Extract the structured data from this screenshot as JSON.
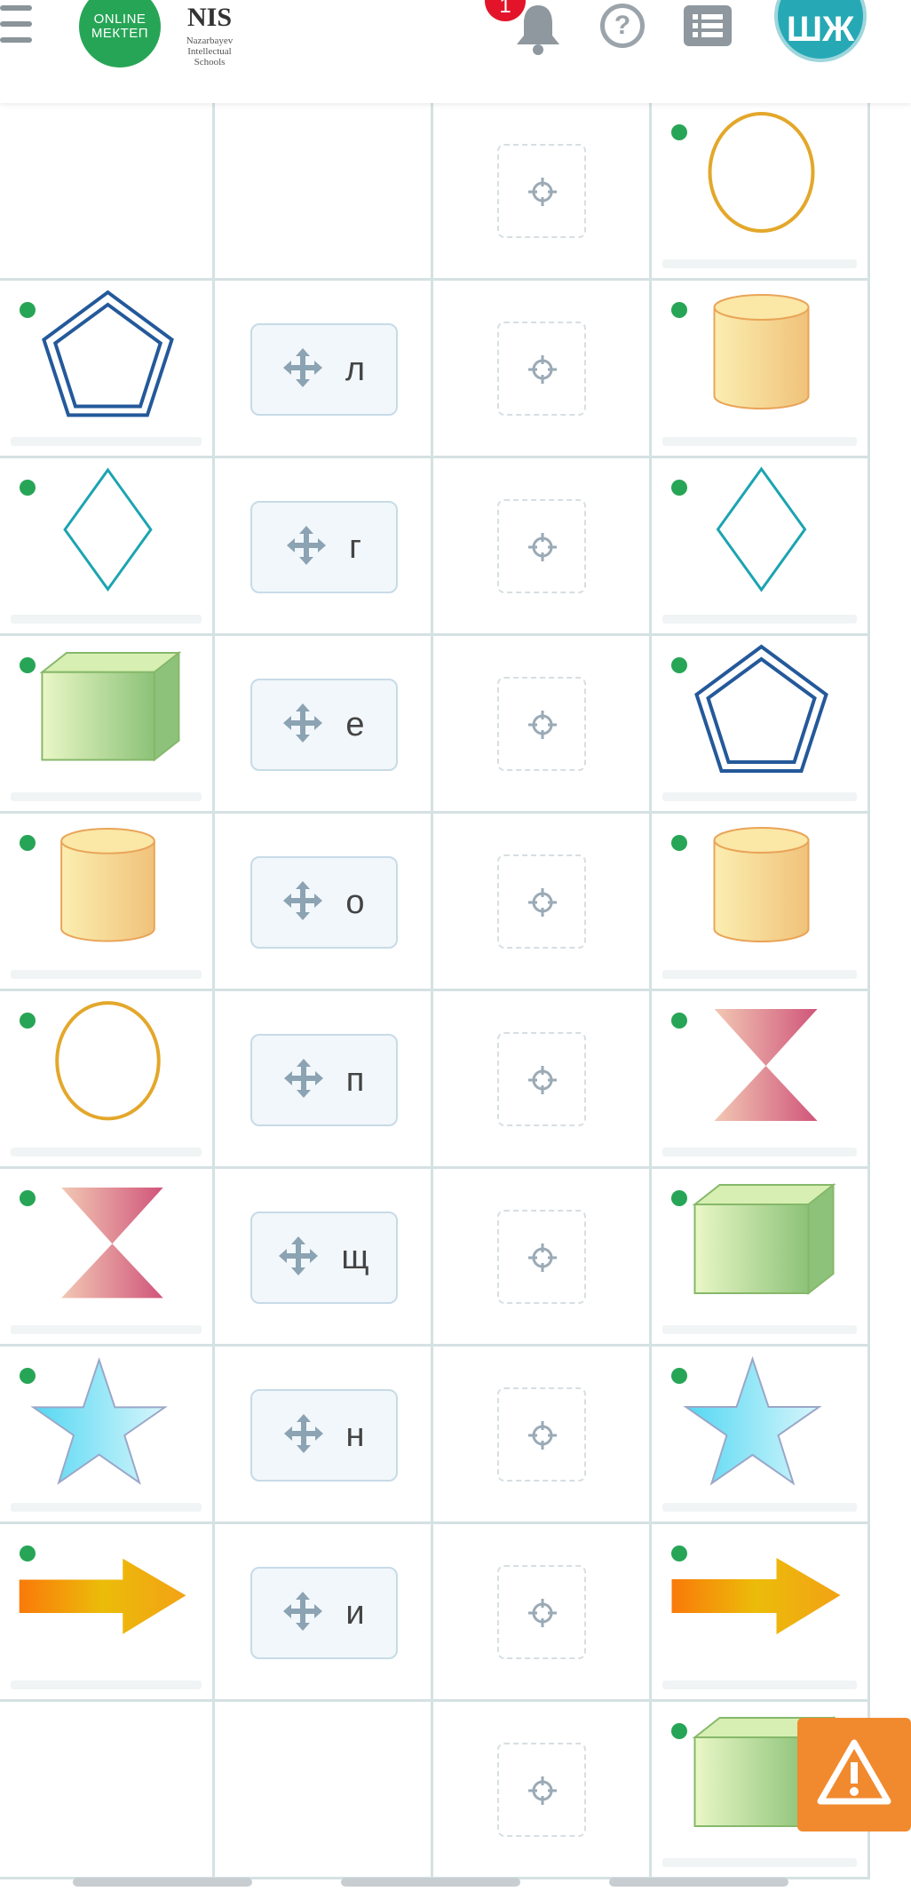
{
  "header": {
    "logo_online": "ONLINE",
    "logo_mektep": "МЕКТЕП",
    "nis_title": "NIS",
    "nis_line1": "Nazarbayev",
    "nis_line2": "Intellectual",
    "nis_line3": "Schools",
    "notification_count": "1",
    "help_symbol": "?",
    "avatar_initials": "ШЖ"
  },
  "colors": {
    "accent_green": "#27a556",
    "avatar_teal": "#26a9b5",
    "badge_red": "#e3142a",
    "warning_orange": "#f18a2f",
    "grid_line": "#d5e1e3"
  },
  "rows": [
    {
      "left_shape": "",
      "drag_label": "",
      "right_shape": "ellipse-icon"
    },
    {
      "left_shape": "pentagon-icon",
      "drag_label": "л",
      "right_shape": "cylinder-icon"
    },
    {
      "left_shape": "rhombus-icon",
      "drag_label": "г",
      "right_shape": "rhombus-icon"
    },
    {
      "left_shape": "cuboid-icon",
      "drag_label": "е",
      "right_shape": "pentagon-icon"
    },
    {
      "left_shape": "cylinder-icon",
      "drag_label": "о",
      "right_shape": "cylinder-icon"
    },
    {
      "left_shape": "ellipse-icon",
      "drag_label": "п",
      "right_shape": "hourglass-icon"
    },
    {
      "left_shape": "hourglass-icon",
      "drag_label": "щ",
      "right_shape": "cuboid-icon"
    },
    {
      "left_shape": "star-icon",
      "drag_label": "н",
      "right_shape": "star-icon"
    },
    {
      "left_shape": "arrow-icon",
      "drag_label": "и",
      "right_shape": "arrow-icon"
    },
    {
      "left_shape": "",
      "drag_label": "",
      "right_shape": "cuboid-icon"
    }
  ]
}
